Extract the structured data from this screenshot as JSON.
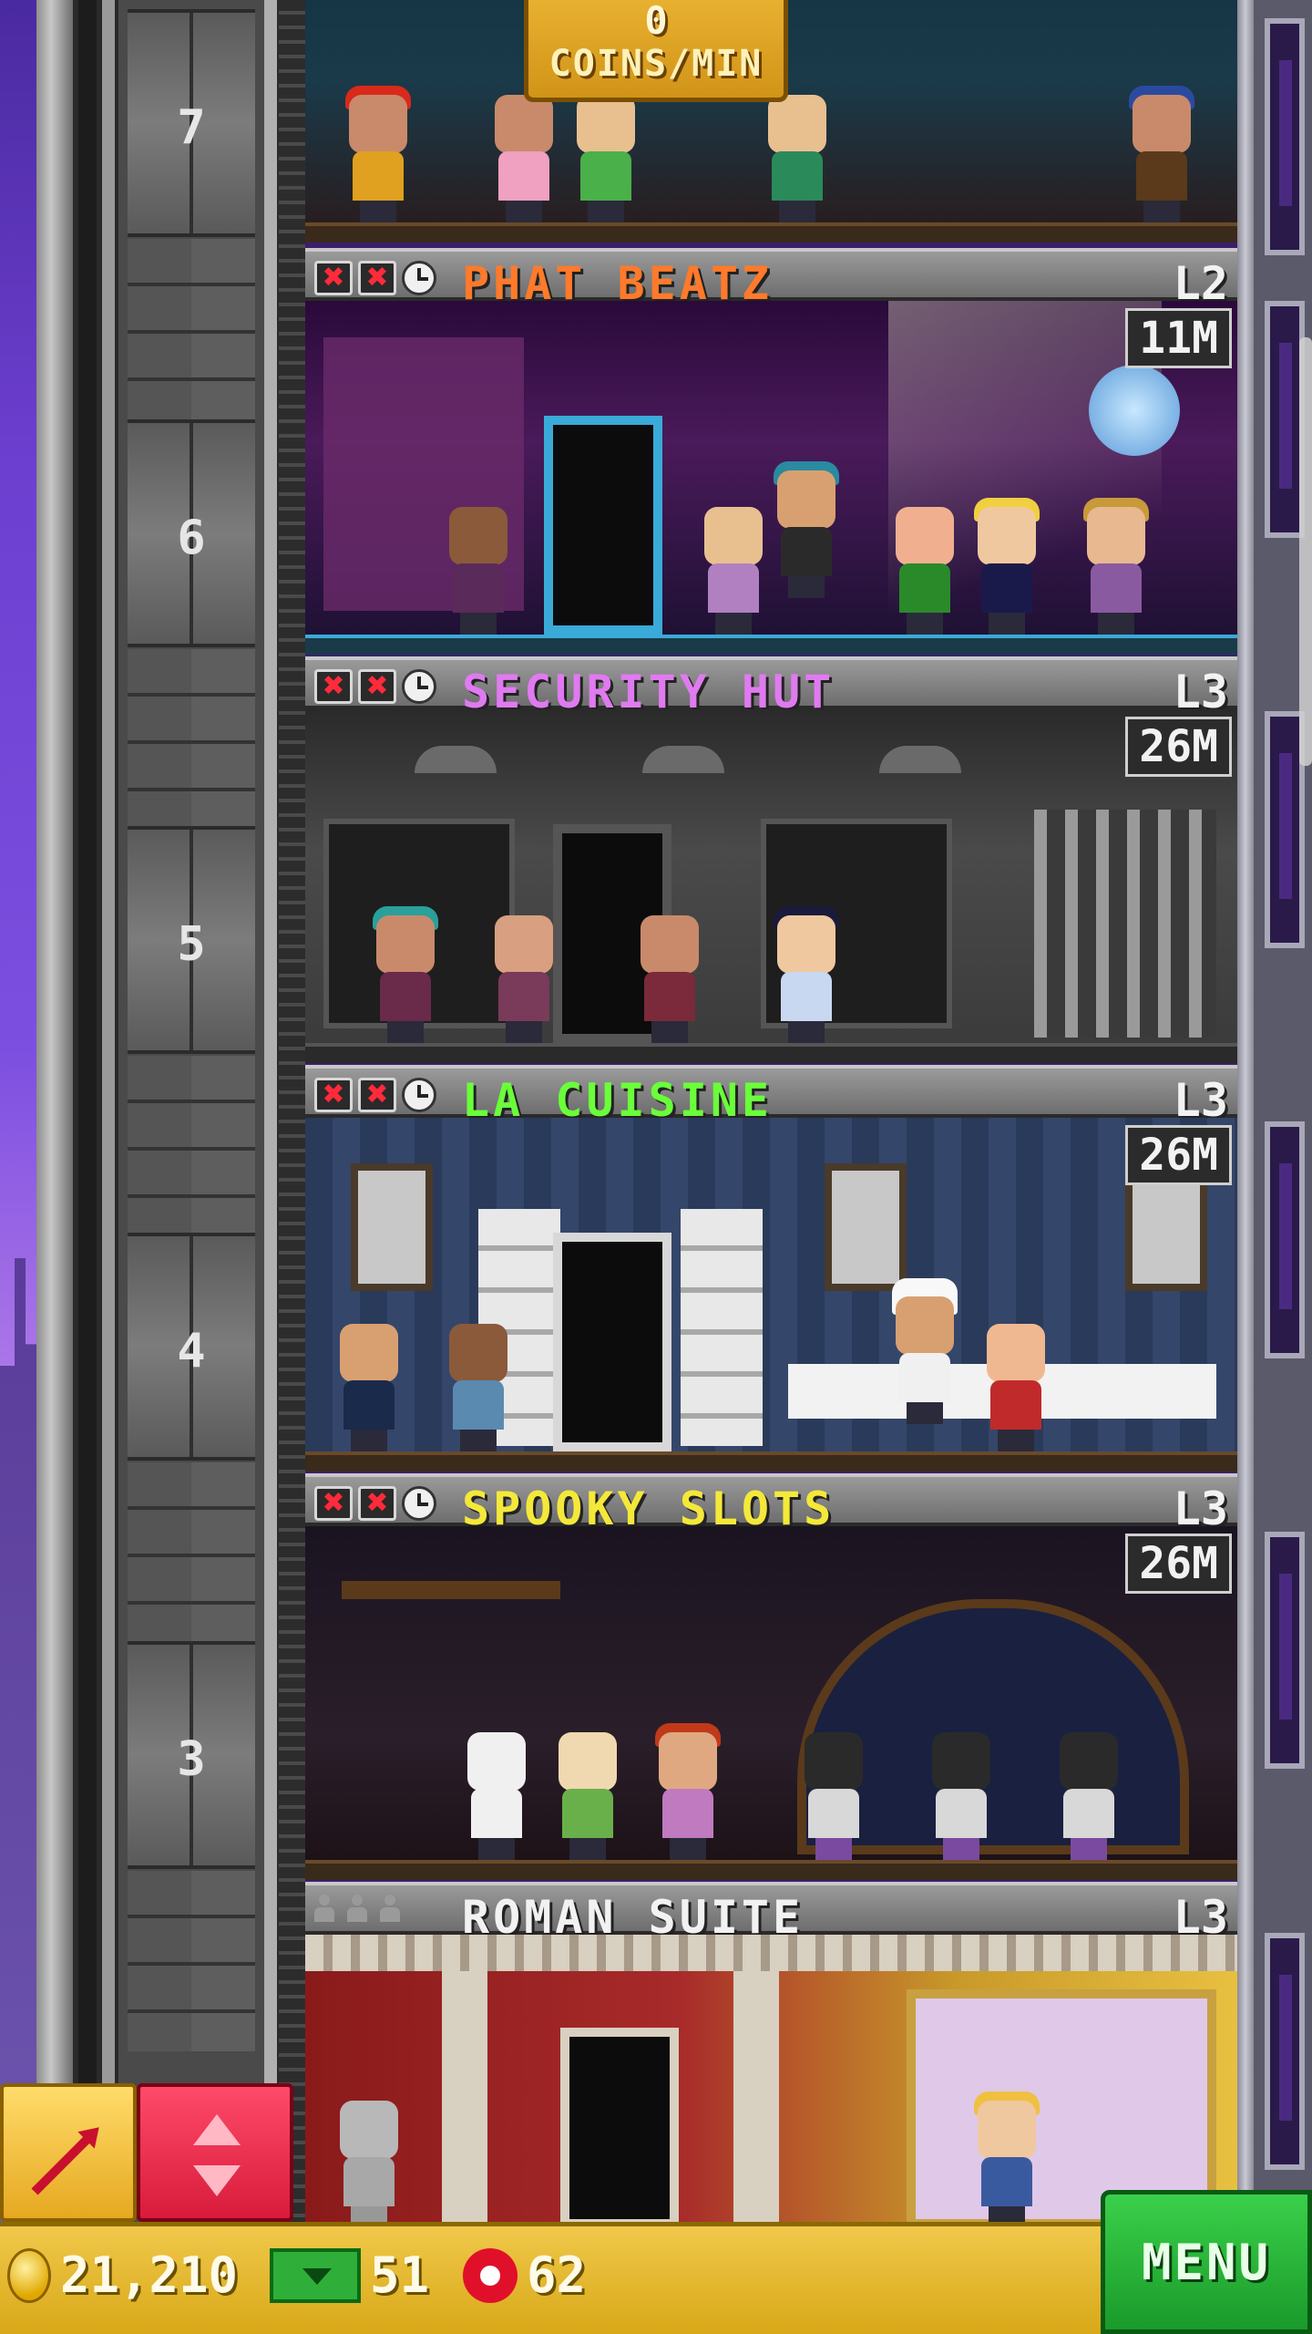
{
  "top_banner": {
    "value": "0",
    "label": "COINS/MIN"
  },
  "floor_numbers": [
    "7",
    "6",
    "5",
    "4",
    "3"
  ],
  "floors": [
    {
      "name": "PHAT BEATZ",
      "level": "L2",
      "timer": "11M",
      "name_color": "#ff7a2a"
    },
    {
      "name": "SECURITY HUT",
      "level": "L3",
      "timer": "26M",
      "name_color": "#e07af0"
    },
    {
      "name": "LA CUISINE",
      "level": "L3",
      "timer": "26M",
      "name_color": "#6aff3a"
    },
    {
      "name": "SPOOKY SLOTS",
      "level": "L3",
      "timer": "26M",
      "name_color": "#f4e83a"
    },
    {
      "name": "ROMAN SUITE",
      "level": "L3",
      "timer": "",
      "name_color": "#f2f2f2"
    }
  ],
  "status_bar": {
    "coins": "21,210",
    "bux": "51",
    "gems": "62"
  },
  "menu_label": "MENU",
  "colors": {
    "coin": "#e0a800",
    "bux": "#2fae3a",
    "gem": "#e0102a",
    "menu": "#2ab83a"
  }
}
